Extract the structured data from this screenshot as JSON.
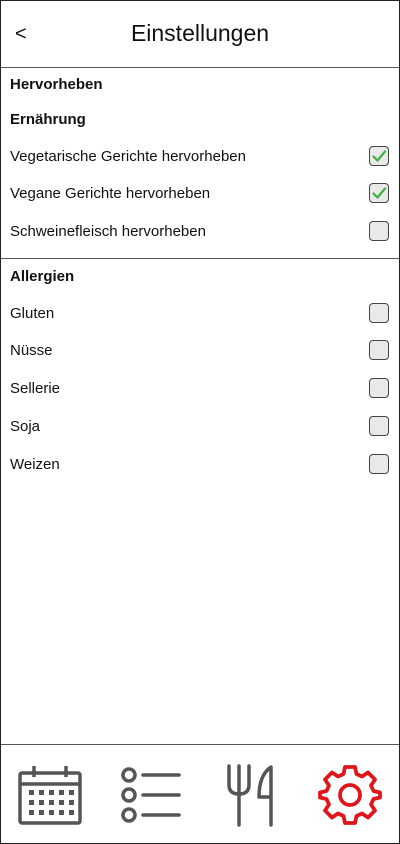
{
  "header": {
    "back_label": "<",
    "title": "Einstellungen"
  },
  "highlight_section": {
    "heading": "Hervorheben",
    "subheading": "Ernährung",
    "items": [
      {
        "label": "Vegetarische Gerichte hervorheben",
        "checked": true
      },
      {
        "label": "Vegane Gerichte hervorheben",
        "checked": true
      },
      {
        "label": "Schweinefleisch hervorheben",
        "checked": false
      }
    ]
  },
  "allergies_section": {
    "heading": "Allergien",
    "items": [
      {
        "label": "Gluten",
        "checked": false
      },
      {
        "label": "Nüsse",
        "checked": false
      },
      {
        "label": "Sellerie",
        "checked": false
      },
      {
        "label": "Soja",
        "checked": false
      },
      {
        "label": "Weizen",
        "checked": false
      }
    ]
  },
  "bottom_nav": {
    "items": [
      {
        "icon": "calendar-icon",
        "active": false
      },
      {
        "icon": "list-icon",
        "active": false
      },
      {
        "icon": "fork-knife-icon",
        "active": false
      },
      {
        "icon": "gear-icon",
        "active": true
      }
    ],
    "active_color": "#e0161b",
    "inactive_color": "#555555"
  },
  "colors": {
    "check_color": "#3cb043"
  }
}
